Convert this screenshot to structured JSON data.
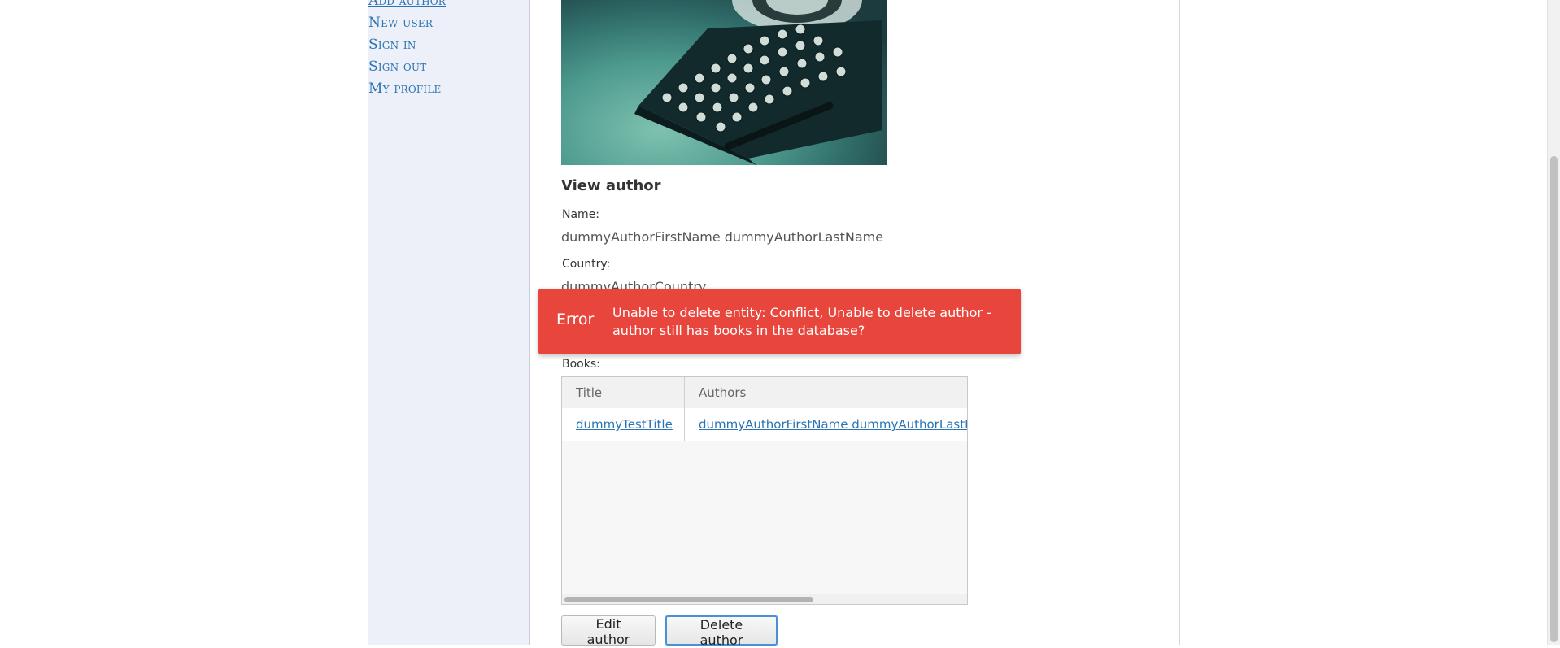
{
  "sidebar": {
    "items": [
      {
        "label": "Add author"
      },
      {
        "label": "New user"
      },
      {
        "label": "Sign in"
      },
      {
        "label": "Sign out"
      },
      {
        "label": "My profile"
      }
    ]
  },
  "view": {
    "title": "View author",
    "name_label": "Name:",
    "name_value": "dummyAuthorFirstName dummyAuthorLastName",
    "country_label": "Country:",
    "country_value": "dummyAuthorCountry",
    "books_label": "Books:"
  },
  "toast": {
    "title": "Error",
    "message": "Unable to delete entity: Conflict, Unable to delete author - author still has books in the database?",
    "color": "#e8453c"
  },
  "books_table": {
    "columns": [
      "Title",
      "Authors"
    ],
    "rows": [
      [
        "dummyTestTitle",
        "dummyAuthorFirstName dummyAuthorLastName"
      ]
    ]
  },
  "actions": {
    "edit_label": "Edit author",
    "delete_label": "Delete author"
  },
  "colors": {
    "link": "#2a74b3",
    "sidebar_bg": "#edf0f8",
    "focus": "#4a90d9"
  }
}
